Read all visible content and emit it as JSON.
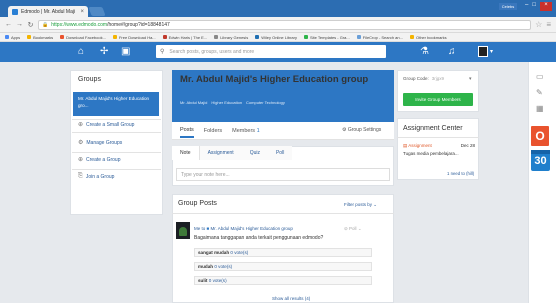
{
  "browser": {
    "tab_title": "Edmodo | Mr. Abdul Maji",
    "user_badge": "Celebs",
    "url_scheme": "https://www.edmodo.com",
    "url_path": "/home#/group?id=18848147",
    "bookmarks": [
      "Apps",
      "Bookmarks",
      "Download Facebook...",
      "Free Download Ha...",
      "Edwin Haris | The E...",
      "Library Genesis",
      "Wiley Online Library",
      "Site Templates - Gra...",
      "FileCrop - Search an...",
      "Other bookmarks"
    ]
  },
  "nav": {
    "search_placeholder": "Search posts, groups, users and more"
  },
  "left": {
    "title": "Groups",
    "active_group": "Mr. Abdul Majid's Higher Education gro...",
    "links": [
      "Create a Small Group",
      "Manage Groups",
      "Create a Group",
      "Join a Group"
    ]
  },
  "group": {
    "title": "Mr. Abdul Majid's Higher Education group",
    "tags": [
      "Mr. Abdul Majid",
      "Higher Education",
      "Computer Technology"
    ],
    "tabs": [
      "Posts",
      "Folders",
      "Members"
    ],
    "members_count": "1",
    "settings_label": "Group Settings"
  },
  "composer": {
    "tabs": [
      "Note",
      "Assignment",
      "Quiz",
      "Poll"
    ],
    "placeholder": "Type your note here..."
  },
  "posts": {
    "title": "Group Posts",
    "filter": "Filter posts by",
    "author": "Me to",
    "group": "Mr. Abdul Majid's Higher Education group",
    "type": "Poll",
    "question": "Bagaimana tanggapan anda terkait penggunaan edmodo?",
    "options": [
      {
        "label": "sangat mudah",
        "votes": "0 vote(s)"
      },
      {
        "label": "mudah",
        "votes": "0 vote(s)"
      },
      {
        "label": "sulit",
        "votes": "0 vote(s)"
      }
    ],
    "show_results": "Show all results (4)"
  },
  "right": {
    "code_label": "Group Code:",
    "code": "3rjgx9",
    "invite": "Invite Group Members",
    "assign_title": "Assignment Center",
    "assign_kind": "Assignment",
    "assign_date": "Dec 28",
    "assign_desc": "Tugas media pembelajara...",
    "assign_due": "1 need to (hill)"
  },
  "sidebar": {
    "calendar_day": "30"
  }
}
